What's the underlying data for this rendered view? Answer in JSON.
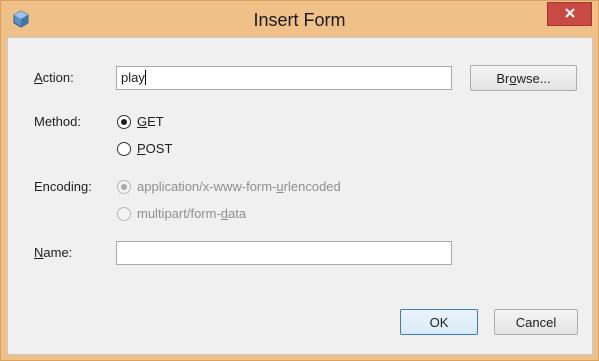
{
  "window": {
    "title": "Insert Form",
    "colors": {
      "titlebar": "#f0c089",
      "close": "#c74a45",
      "content": "#f0f0f0"
    }
  },
  "form": {
    "action": {
      "label_mnemonic": "A",
      "label_rest": "ction:",
      "value": "play",
      "browse_pre": "Br",
      "browse_mnemonic": "o",
      "browse_post": "wse..."
    },
    "method": {
      "label": "Method:",
      "options": [
        {
          "pre": "",
          "mnemonic": "G",
          "post": "ET",
          "checked": true
        },
        {
          "pre": "",
          "mnemonic": "P",
          "post": "OST",
          "checked": false
        }
      ]
    },
    "encoding": {
      "label": "Encoding:",
      "options": [
        {
          "pre": "application/x-www-form-",
          "mnemonic": "u",
          "post": "rlencoded",
          "checked": true,
          "disabled": true
        },
        {
          "pre": "multipart/form-",
          "mnemonic": "d",
          "post": "ata",
          "checked": false,
          "disabled": true
        }
      ]
    },
    "name": {
      "label_mnemonic": "N",
      "label_rest": "ame:",
      "value": ""
    }
  },
  "buttons": {
    "ok": "OK",
    "cancel": "Cancel"
  }
}
